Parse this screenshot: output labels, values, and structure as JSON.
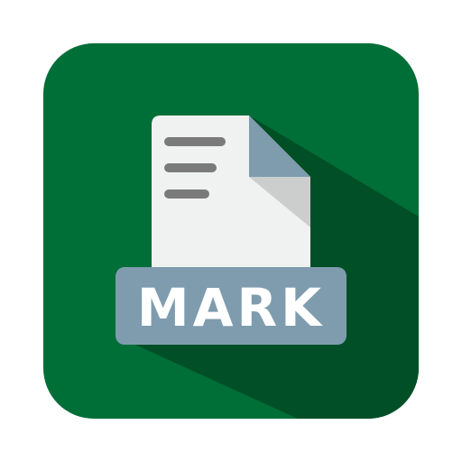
{
  "icon": {
    "name": "mark-file-icon",
    "label": "MARK",
    "colors": {
      "background": "#006E37",
      "shadow": "#004F26",
      "page": "#F0F2F1",
      "fold": "#7E9CAE",
      "fold_inner": "#CBCECD",
      "text_lines": "#7A7A7A",
      "label_plate": "#7E9CAE",
      "label_text": "#FFFFFF"
    }
  }
}
